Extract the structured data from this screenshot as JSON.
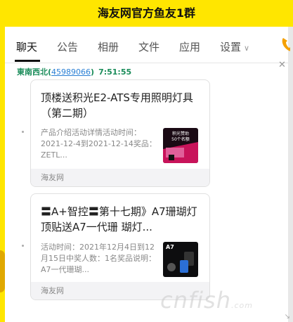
{
  "window": {
    "title": "海友网官方鱼友1群"
  },
  "tabs": [
    {
      "label": "聊天",
      "active": true
    },
    {
      "label": "公告"
    },
    {
      "label": "相册"
    },
    {
      "label": "文件"
    },
    {
      "label": "应用"
    },
    {
      "label": "设置"
    }
  ],
  "message": {
    "sender_name": "東南西北",
    "sender_qq": "45989066",
    "time": "7:51:55"
  },
  "cards": [
    {
      "title": "顶楼送积光E2-ATS专用照明灯具（第二期）",
      "desc": "产品介绍活动详情活动时间：2021-12-4到2021-12-14奖品：ZETL...",
      "source": "海友网",
      "thumb_text": "积光赞助\n50个名额"
    },
    {
      "title": "〓A+智控〓第十七期》A7珊瑚灯顶贴送A7一代珊 瑚灯...",
      "desc": "活动时间：2021年12月4日到12月15日中奖人数：1名奖品说明：A7一代珊瑚...",
      "source": "海友网",
      "thumb_text": "A7"
    }
  ],
  "watermark": {
    "text": "cnfish",
    "suffix": ".com"
  },
  "colors": {
    "title_bar": "#ffe600",
    "sender": "#1a8c5a",
    "qq_link": "#2a7fd4"
  }
}
